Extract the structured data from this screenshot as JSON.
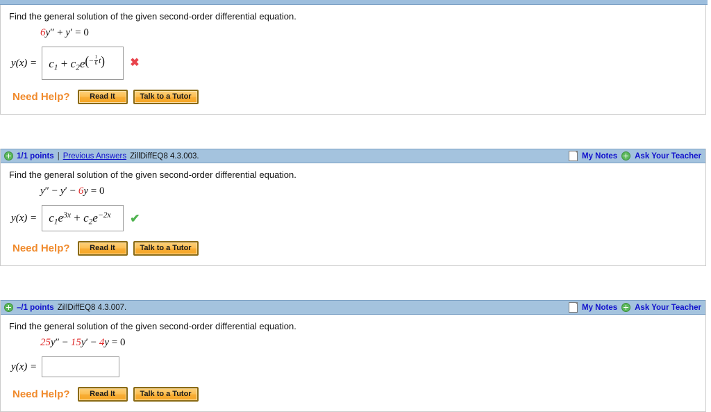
{
  "page": {
    "prompt": "Find the general solution of the given second-order differential equation."
  },
  "need_help": {
    "label": "Need Help?",
    "read_it": "Read It",
    "talk_to_tutor": "Talk to a Tutor"
  },
  "header_common": {
    "my_notes": "My Notes",
    "ask_your_teacher": "Ask Your Teacher",
    "previous_answers": "Previous Answers",
    "separator": "|"
  },
  "colors": {
    "header_bar": "#a4c3de",
    "link_blue": "#1111cc",
    "coefficient_red": "#e02b2b",
    "need_help_orange": "#f08a2c",
    "button_orange": "#f5a623",
    "wrong_red": "#e8434c",
    "correct_green": "#4fb34f"
  },
  "problems": [
    {
      "id": "problem-1",
      "prompt": "Find the general solution of the given second-order differential equation.",
      "equation_text": "6y'' + y' = 0",
      "equation_parts": {
        "c1": "6",
        "y2": "y",
        "primes2": "″",
        "op1": "+",
        "y1": "y",
        "primes1": "′",
        "eq": "=",
        "rhs": "0"
      },
      "lhs": "y(x) =",
      "answer_text": "c_1 + c_2 e^(-(1/6) t)",
      "answer_parts": {
        "c": "c",
        "sub1": "1",
        "plus": "+",
        "sub2": "2",
        "e": "e",
        "minus": "−",
        "frac_num": "1",
        "frac_den": "6",
        "var": "t"
      },
      "status": "wrong",
      "status_mark": "✖",
      "has_answer_box_content": true,
      "header": null
    },
    {
      "id": "problem-2",
      "prompt": "Find the general solution of the given second-order differential equation.",
      "header": {
        "points": "1/1 points",
        "previous_answers": "Previous Answers",
        "problem_id": "ZillDiffEQ8 4.3.003.",
        "my_notes": "My Notes",
        "ask_your_teacher": "Ask Your Teacher",
        "show_previous_answers": true
      },
      "equation_text": "y'' - y' - 6y = 0",
      "equation_parts": {
        "y2": "y",
        "primes2": "″",
        "op1": "−",
        "y1": "y",
        "primes1": "′",
        "op2": "−",
        "coef": "6",
        "y0": "y",
        "eq": "=",
        "rhs": "0"
      },
      "lhs": "y(x) =",
      "answer_text": "c_1 e^(3x) + c_2 e^(-2x)",
      "answer_parts": {
        "c": "c",
        "sub1": "1",
        "e": "e",
        "exp1": "3x",
        "plus": "+",
        "sub2": "2",
        "exp2": "−2x"
      },
      "status": "correct",
      "status_mark": "✔",
      "has_answer_box_content": true
    },
    {
      "id": "problem-3",
      "prompt": "Find the general solution of the given second-order differential equation.",
      "header": {
        "points": "–/1 points",
        "problem_id": "ZillDiffEQ8 4.3.007.",
        "my_notes": "My Notes",
        "ask_your_teacher": "Ask Your Teacher",
        "show_previous_answers": false
      },
      "equation_text": "25y'' - 15y' - 4y = 0",
      "equation_parts": {
        "c1": "25",
        "y2": "y",
        "primes2": "″",
        "op1": "−",
        "c2": "15",
        "y1": "y",
        "primes1": "′",
        "op2": "−",
        "c3": "4",
        "y0": "y",
        "eq": "=",
        "rhs": "0"
      },
      "lhs": "y(x) =",
      "answer_text": "",
      "status": "none",
      "has_answer_box_content": false
    }
  ]
}
